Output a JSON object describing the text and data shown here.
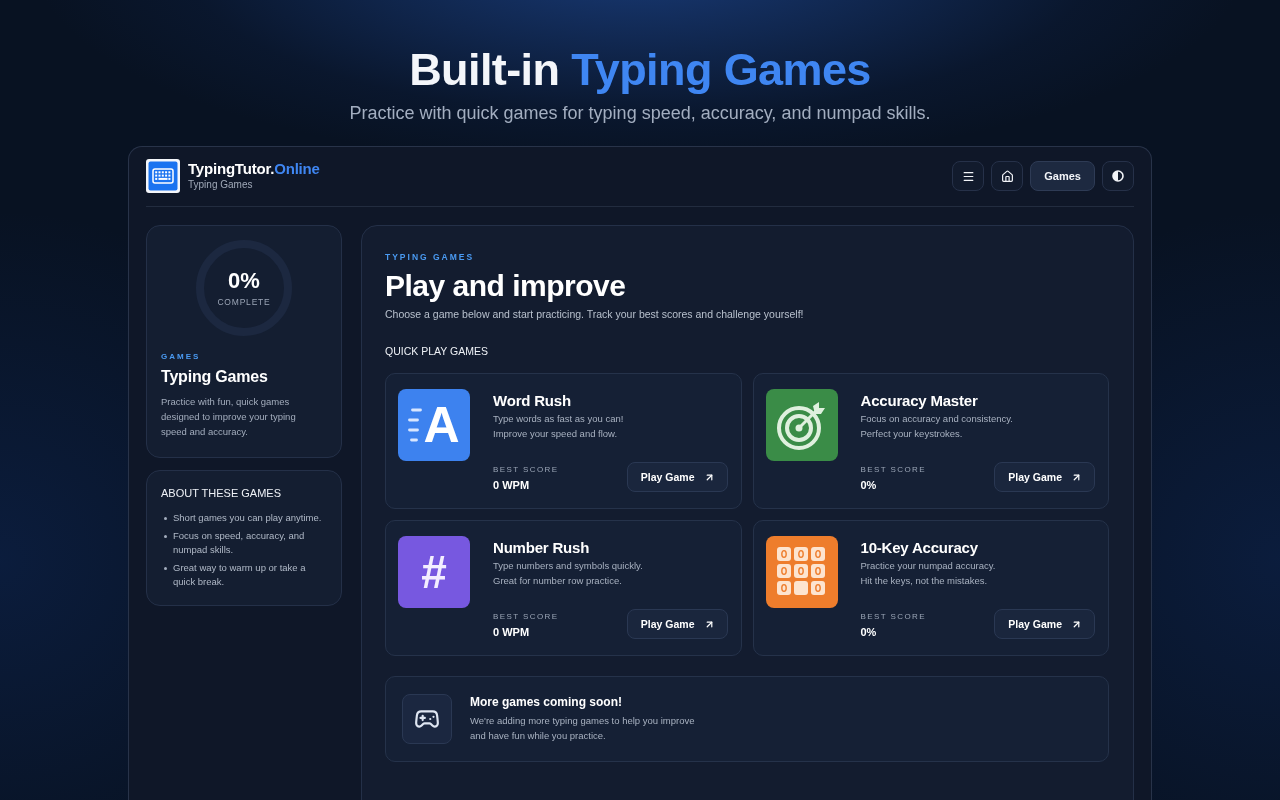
{
  "hero": {
    "title": [
      {
        "text": "Built-in ",
        "highlight": false
      },
      {
        "text": "Typing Games",
        "highlight": true
      }
    ],
    "subtitle": "Practice with quick games for typing speed, accuracy, and numpad skills."
  },
  "app": {
    "brand": {
      "name": [
        {
          "text": "TypingTutor.",
          "highlight": false
        },
        {
          "text": "Online",
          "highlight": true
        }
      ],
      "subtitle": "Typing Games"
    },
    "nav": [
      {
        "kind": "menu",
        "selected": false
      },
      {
        "kind": "home",
        "selected": false
      },
      {
        "kind": "text",
        "label": "Games",
        "selected": true
      },
      {
        "kind": "theme",
        "selected": false
      }
    ]
  },
  "sidebar": {
    "progress": {
      "value": "0%",
      "label": "COMPLETE",
      "level": 0
    },
    "eyebrow": "GAMES",
    "title": "Typing Games",
    "text": "Practice with fun, quick games designed to improve your typing speed and accuracy.",
    "about": {
      "title": "ABOUT THESE GAMES",
      "items": [
        "Short games you can play anytime.",
        "Focus on speed, accuracy, and numpad skills.",
        "Great way to warm up or take a quick break."
      ]
    }
  },
  "main": {
    "eyebrow": "TYPING GAMES",
    "title": "Play and improve",
    "intro": "Choose a game below and start practicing. Track your best scores and challenge yourself!",
    "section_title": "QUICK PLAY GAMES",
    "games": [
      {
        "title": "Word Rush",
        "description_lines": [
          "Type words as fast as you can!",
          "Improve your speed and flow."
        ],
        "score_label": "BEST SCORE",
        "score": "0 WPM",
        "button": "Play Game",
        "icon": {
          "kind": "speed-letter",
          "glyph": "A"
        },
        "color": "#3d82ef"
      },
      {
        "title": "Accuracy Master",
        "description_lines": [
          "Focus on accuracy and consistency.",
          "Perfect your keystrokes."
        ],
        "score_label": "BEST SCORE",
        "score": "0%",
        "button": "Play Game",
        "icon": {
          "kind": "target"
        },
        "color": "#3a8c47"
      },
      {
        "title": "Number Rush",
        "description_lines": [
          "Type numbers and symbols quickly.",
          "Great for number row practice."
        ],
        "score_label": "BEST SCORE",
        "score": "0 WPM",
        "button": "Play Game",
        "icon": {
          "kind": "glyph",
          "glyph": "#"
        },
        "color": "#7758e0"
      },
      {
        "title": "10-Key Accuracy",
        "description_lines": [
          "Practice your numpad accuracy.",
          "Hit the keys, not the mistakes."
        ],
        "score_label": "BEST SCORE",
        "score": "0%",
        "button": "Play Game",
        "icon": {
          "kind": "keypad"
        },
        "color": "#ee7d2c"
      }
    ],
    "notice": {
      "title": "More games coming soon!",
      "text_lines": [
        "We're adding more typing games to help you improve",
        "and have fun while you practice."
      ]
    }
  }
}
